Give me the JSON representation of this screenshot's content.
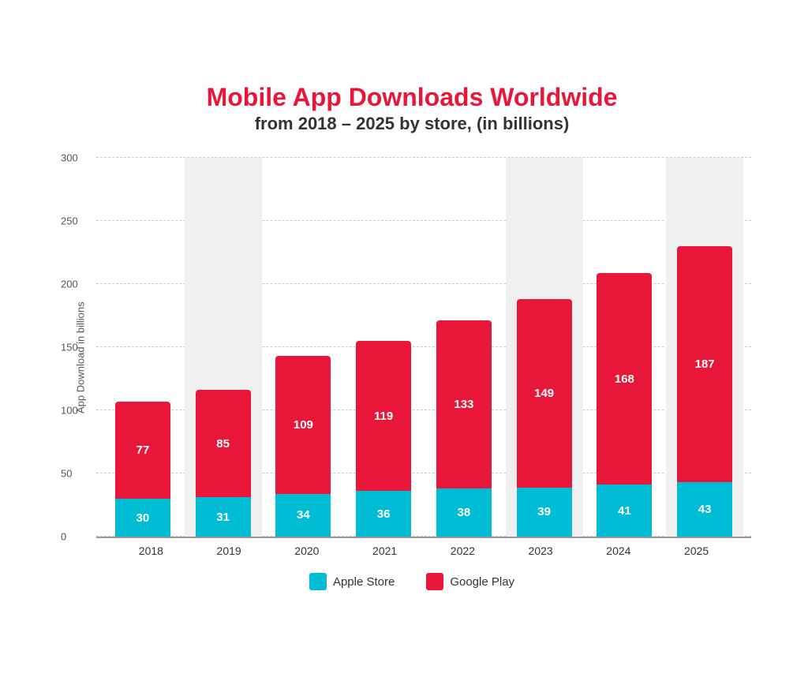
{
  "title": {
    "main": "Mobile App Downloads Worldwide",
    "sub": "from 2018 – 2025 by store, (in billions)"
  },
  "yAxis": {
    "label": "App Download in billions",
    "ticks": [
      0,
      50,
      100,
      150,
      200,
      250,
      300
    ]
  },
  "bars": [
    {
      "year": "2018",
      "apple": 30,
      "google": 77,
      "shaded": false
    },
    {
      "year": "2019",
      "apple": 31,
      "google": 85,
      "shaded": true
    },
    {
      "year": "2020",
      "apple": 34,
      "google": 109,
      "shaded": false
    },
    {
      "year": "2021",
      "apple": 36,
      "google": 119,
      "shaded": false
    },
    {
      "year": "2022",
      "apple": 38,
      "google": 133,
      "shaded": false
    },
    {
      "year": "2023",
      "apple": 39,
      "google": 149,
      "shaded": true
    },
    {
      "year": "2024",
      "apple": 41,
      "google": 168,
      "shaded": false
    },
    {
      "year": "2025",
      "apple": 43,
      "google": 187,
      "shaded": true
    }
  ],
  "legend": {
    "apple": "Apple Store",
    "google": "Google Play"
  },
  "colors": {
    "apple": "#00bcd4",
    "google": "#e8173a",
    "title": "#e8173a",
    "subtitle": "#333333"
  }
}
